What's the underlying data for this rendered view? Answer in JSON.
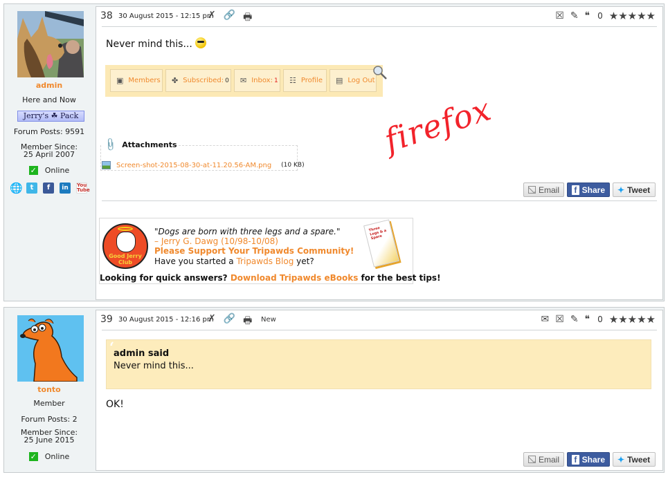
{
  "posts": [
    {
      "author": {
        "name": "admin",
        "title": "Here and Now",
        "badge": "Jerry's ☘ Pack",
        "forum_posts": "Forum Posts: 9591",
        "member_since_label": "Member Since:",
        "member_since_date": "25 April 2007",
        "status": "Online",
        "social": [
          "website-icon",
          "twitter-icon",
          "facebook-icon",
          "linkedin-icon",
          "youtube-icon"
        ]
      },
      "number": "38",
      "date": "30 August 2015 - 12:15 pm",
      "header_icons": [
        "tools-icon",
        "link-icon",
        "print-icon"
      ],
      "right_icons": [
        "delete-post-icon",
        "edit-post-icon",
        "quote-post-icon"
      ],
      "rating_count": "0",
      "stars": "★★★★★",
      "message": "Never mind this...",
      "toolbar": [
        {
          "icon": "▣",
          "label": "Members",
          "count": ""
        },
        {
          "icon": "✤",
          "label": "Subscribed:",
          "count": "0"
        },
        {
          "icon": "✉",
          "label": "Inbox:",
          "count": "1"
        },
        {
          "icon": "☷",
          "label": "Profile",
          "count": ""
        },
        {
          "icon": "▤",
          "label": "Log Out",
          "count": ""
        }
      ],
      "annotation": "firefox",
      "attachments": {
        "title": "Attachments",
        "files": [
          {
            "name": "Screen-shot-2015-08-30-at-11.20.56-AM.png",
            "size": "(10 KB)"
          }
        ]
      },
      "share": {
        "email": "Email",
        "share": "Share",
        "tweet": "Tweet"
      },
      "signature": {
        "badge_text": "Good Jerry Club",
        "quote": "\"Dogs are born with three legs and a spare.\"",
        "author": "– Jerry G. Dawg (10/98-10/08)",
        "support": "Please Support Your Tripawds Community!",
        "blog_prefix": "Have you started a ",
        "blog_link": "Tripawds Blog",
        "blog_suffix": " yet?",
        "bottom_prefix": "Looking for quick answers? ",
        "bottom_link": "Download Tripawds eBooks",
        "bottom_suffix": " for the best tips!",
        "book_title": "Three Legs & a Spare"
      }
    },
    {
      "author": {
        "name": "tonto",
        "title": "Member",
        "forum_posts": "Forum Posts: 2",
        "member_since_label": "Member Since:",
        "member_since_date": "25 June 2015",
        "status": "Online"
      },
      "number": "39",
      "date": "30 August 2015 - 12:16 pm",
      "new_label": "New",
      "right_icons": [
        "pm-icon",
        "delete-post-icon",
        "edit-post-icon",
        "quote-post-icon"
      ],
      "rating_count": "0",
      "stars": "★★★★★",
      "quote": {
        "who": "admin said",
        "text": "Never mind this..."
      },
      "message": "OK!",
      "share": {
        "email": "Email",
        "share": "Share",
        "tweet": "Tweet"
      }
    }
  ]
}
